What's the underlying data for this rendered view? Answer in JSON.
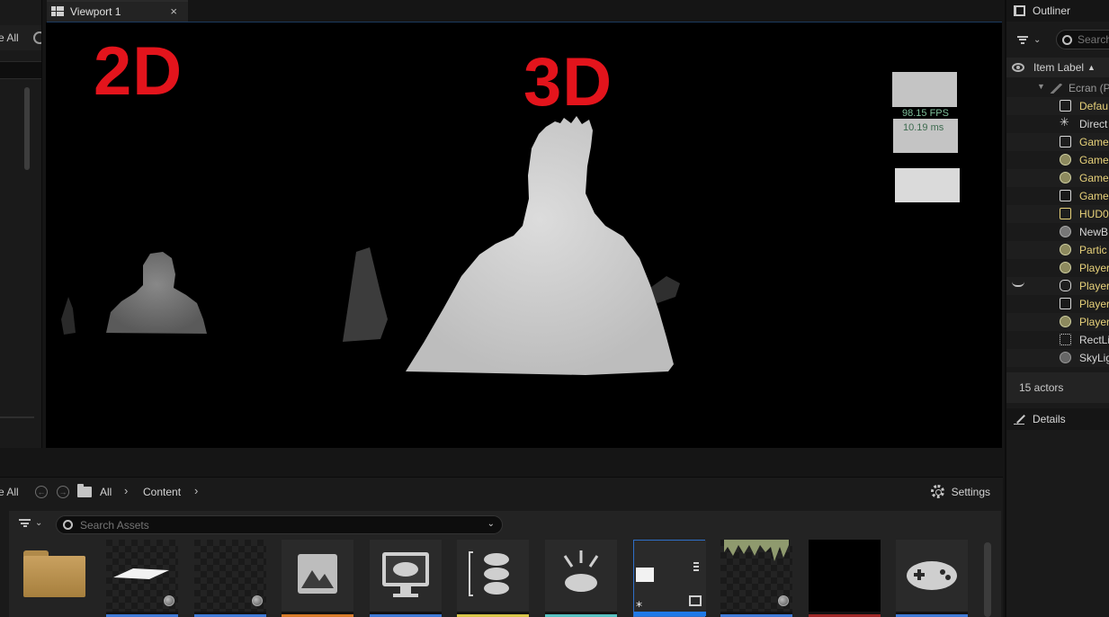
{
  "left_panel": {
    "label": "e All"
  },
  "viewport": {
    "tab_label": "Viewport 1",
    "close_glyph": "×",
    "label_2d": "2D",
    "label_3d": "3D",
    "fps": "98.15 FPS",
    "ms": "10.19 ms",
    "accent_color": "#e3141c"
  },
  "outliner": {
    "title": "Outliner",
    "search_placeholder": "Search",
    "column_header": "Item Label",
    "sort_glyph": "▲",
    "rows": [
      {
        "label": "Ecran (P",
        "icon": "world-icon",
        "style": "grey"
      },
      {
        "label": "Defau",
        "icon": "default-pawn-icon",
        "style": "yellow"
      },
      {
        "label": "Direct",
        "icon": "directional-light-icon",
        "style": "white"
      },
      {
        "label": "Game",
        "icon": "game-image-icon",
        "style": "yellow"
      },
      {
        "label": "Game",
        "icon": "blueprint-sphere-icon",
        "style": "yellow"
      },
      {
        "label": "Game",
        "icon": "blueprint-sphere-icon",
        "style": "yellow"
      },
      {
        "label": "Game",
        "icon": "game-state-icon",
        "style": "yellow"
      },
      {
        "label": "HUD0",
        "icon": "hud-icon",
        "style": "yellow"
      },
      {
        "label": "NewB",
        "icon": "blueprint-sphere-icon",
        "style": "white"
      },
      {
        "label": "Partic",
        "icon": "blueprint-sphere-icon",
        "style": "yellow"
      },
      {
        "label": "Player",
        "icon": "blueprint-sphere-icon",
        "style": "yellow"
      },
      {
        "label": "Player",
        "icon": "gamepad-icon",
        "style": "yellow"
      },
      {
        "label": "Player",
        "icon": "player-controller-icon",
        "style": "yellow"
      },
      {
        "label": "Player",
        "icon": "blueprint-sphere-icon",
        "style": "yellow"
      },
      {
        "label": "RectLi",
        "icon": "rect-light-icon",
        "style": "white"
      },
      {
        "label": "SkyLig",
        "icon": "sky-light-icon",
        "style": "white"
      }
    ],
    "actor_count": "15 actors",
    "details_title": "Details"
  },
  "content_browser": {
    "save_all": "e All",
    "breadcrumbs": [
      "All",
      "Content"
    ],
    "settings_label": "Settings",
    "search_placeholder": "Search Assets",
    "tiles": [
      {
        "name": "material-plane",
        "bar_color": "#3f7ad6"
      },
      {
        "name": "blueprint-asset",
        "bar_color": "#3f7ad6"
      },
      {
        "name": "texture-asset",
        "bar_color": "#d77b2a"
      },
      {
        "name": "game-screen-asset",
        "bar_color": "#3f7ad6"
      },
      {
        "name": "input-mapping-asset",
        "bar_color": "#d8c64a"
      },
      {
        "name": "input-action-asset",
        "bar_color": "#57c1c1"
      },
      {
        "name": "widget-asset",
        "bar_color": "#1f7ae8"
      },
      {
        "name": "landscape-material-asset",
        "bar_color": "#3f7ad6"
      },
      {
        "name": "render-target-asset",
        "bar_color": "#a02828"
      },
      {
        "name": "game-mode-asset",
        "bar_color": "#3f7ad6"
      }
    ]
  }
}
